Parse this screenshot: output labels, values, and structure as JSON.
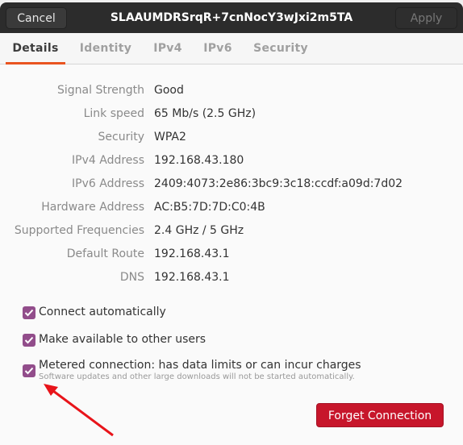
{
  "header": {
    "title": "SLAAUMDRSrqR+7cnNocY3wJxi2m5TA",
    "cancel_label": "Cancel",
    "apply_label": "Apply"
  },
  "tabs": [
    {
      "label": "Details",
      "active": true
    },
    {
      "label": "Identity",
      "active": false
    },
    {
      "label": "IPv4",
      "active": false
    },
    {
      "label": "IPv6",
      "active": false
    },
    {
      "label": "Security",
      "active": false
    }
  ],
  "details": [
    {
      "label": "Signal Strength",
      "value": "Good"
    },
    {
      "label": "Link speed",
      "value": "65 Mb/s (2.5 GHz)"
    },
    {
      "label": "Security",
      "value": "WPA2"
    },
    {
      "label": "IPv4 Address",
      "value": "192.168.43.180"
    },
    {
      "label": "IPv6 Address",
      "value": "2409:4073:2e86:3bc9:3c18:ccdf:a09d:7d02"
    },
    {
      "label": "Hardware Address",
      "value": "AC:B5:7D:7D:C0:4B"
    },
    {
      "label": "Supported Frequencies",
      "value": "2.4 GHz / 5 GHz"
    },
    {
      "label": "Default Route",
      "value": "192.168.43.1"
    },
    {
      "label": "DNS",
      "value": "192.168.43.1"
    }
  ],
  "options": {
    "connect_automatically": {
      "label": "Connect automatically",
      "checked": true
    },
    "available_to_others": {
      "label": "Make available to other users",
      "checked": true
    },
    "metered": {
      "label": "Metered connection: has data limits or can incur charges",
      "sublabel": "Software updates and other large downloads will not be started automatically.",
      "checked": true
    }
  },
  "forget_label": "Forget Connection",
  "colors": {
    "accent_tab": "#e95420",
    "checkbox": "#924d8b",
    "destructive": "#c7162b",
    "annotation_arrow": "#e8141a"
  }
}
